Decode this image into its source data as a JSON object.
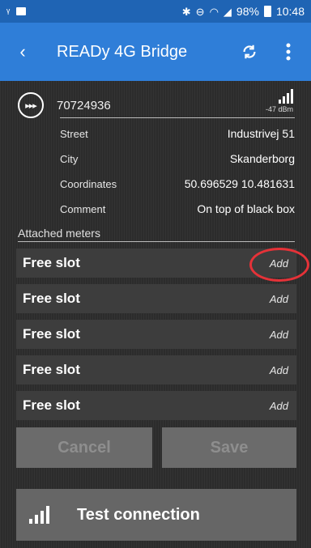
{
  "status_bar": {
    "time": "10:48",
    "battery": "98%",
    "colors": {
      "background": "#1f64b4"
    }
  },
  "app_bar": {
    "title": "READy 4G Bridge",
    "back_icon": "back-arrow-icon",
    "refresh_icon": "refresh-icon",
    "menu_icon": "overflow-menu-icon",
    "colors": {
      "background": "#2f7ed8"
    }
  },
  "device": {
    "id": "70724936",
    "signal_strength": "-47 dBm",
    "icon": "meter-device-icon",
    "info": [
      {
        "label": "Street",
        "value": "Industrivej 51"
      },
      {
        "label": "City",
        "value": "Skanderborg"
      },
      {
        "label": "Coordinates",
        "value": "50.696529 10.481631"
      },
      {
        "label": "Comment",
        "value": "On top of black box"
      }
    ]
  },
  "attached_meters": {
    "label": "Attached meters",
    "slots": [
      {
        "label": "Free slot",
        "action": "Add"
      },
      {
        "label": "Free slot",
        "action": "Add"
      },
      {
        "label": "Free slot",
        "action": "Add"
      },
      {
        "label": "Free slot",
        "action": "Add"
      },
      {
        "label": "Free slot",
        "action": "Add"
      }
    ]
  },
  "actions": {
    "cancel_label": "Cancel",
    "save_label": "Save",
    "test_connection_label": "Test connection"
  },
  "colors": {
    "highlight": "#e53238",
    "disabled_button": "#6b6b6b"
  }
}
